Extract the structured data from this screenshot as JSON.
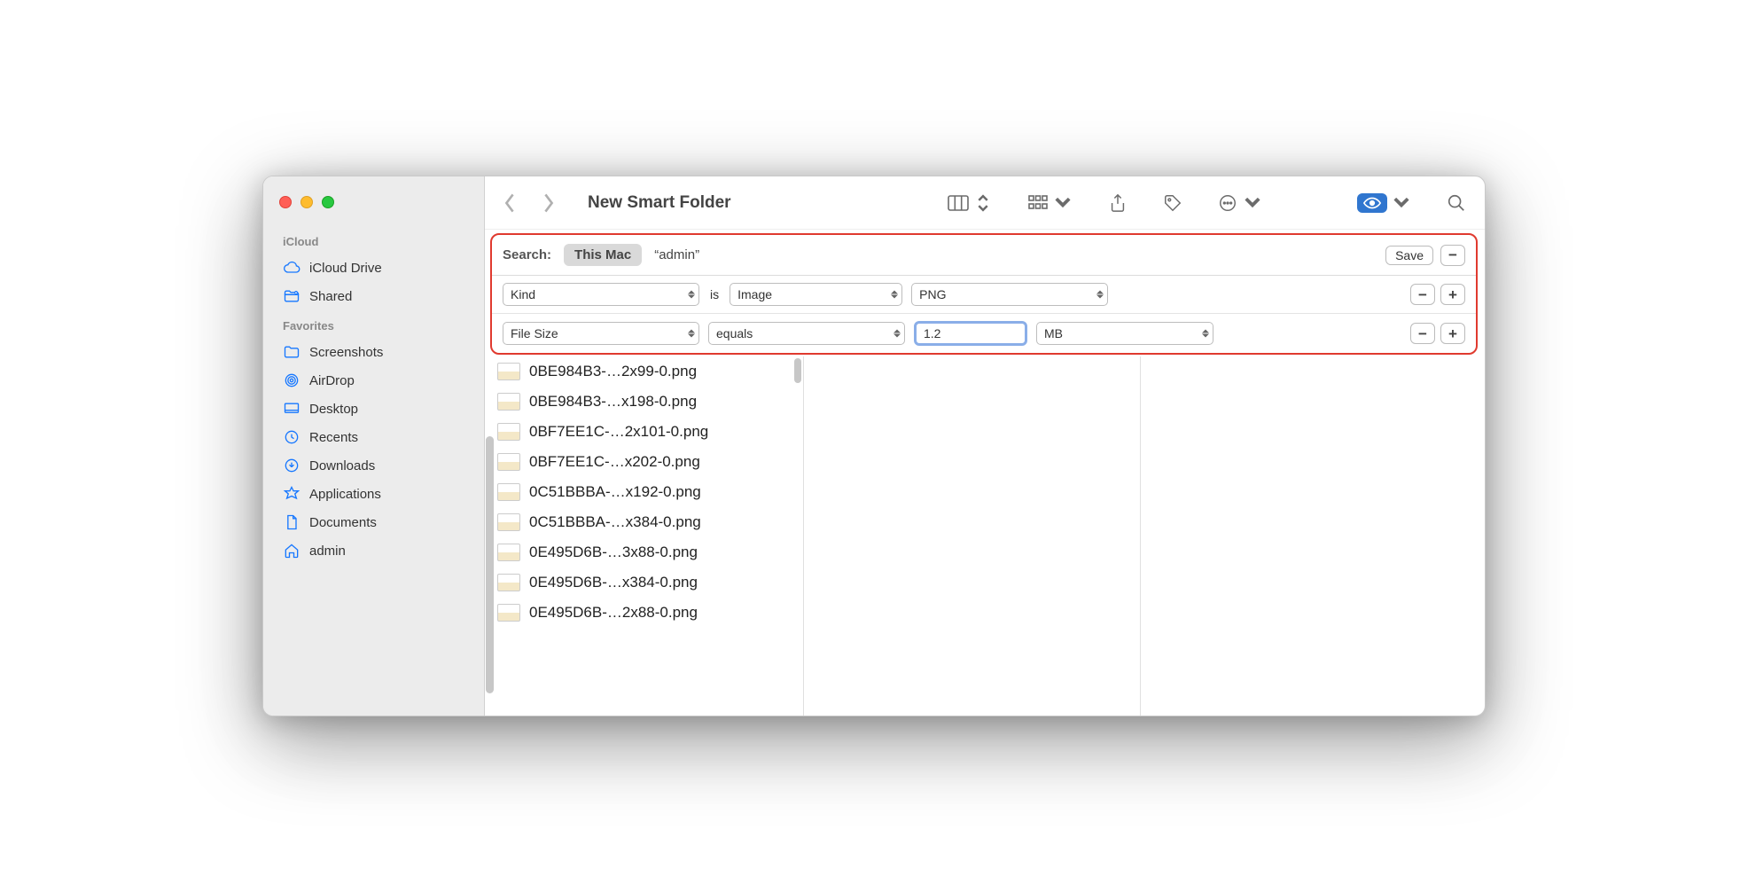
{
  "window": {
    "title": "New Smart Folder"
  },
  "sidebar": {
    "sections": [
      {
        "header": "iCloud",
        "items": [
          {
            "label": "iCloud Drive"
          },
          {
            "label": "Shared"
          }
        ]
      },
      {
        "header": "Favorites",
        "items": [
          {
            "label": "Screenshots"
          },
          {
            "label": "AirDrop"
          },
          {
            "label": "Desktop"
          },
          {
            "label": "Recents"
          },
          {
            "label": "Downloads"
          },
          {
            "label": "Applications"
          },
          {
            "label": "Documents"
          },
          {
            "label": "admin"
          }
        ]
      }
    ]
  },
  "search": {
    "label": "Search:",
    "scope_selected": "This Mac",
    "scope_other": "admin",
    "save_label": "Save"
  },
  "criteria": [
    {
      "attribute": "Kind",
      "joiner": "is",
      "value1": "Image",
      "value2": "PNG"
    },
    {
      "attribute": "File Size",
      "joiner": "equals",
      "input": "1.2",
      "unit": "MB"
    }
  ],
  "files": [
    "0BE984B3-…2x99-0.png",
    "0BE984B3-…x198-0.png",
    "0BF7EE1C-…2x101-0.png",
    "0BF7EE1C-…x202-0.png",
    "0C51BBBA-…x192-0.png",
    "0C51BBBA-…x384-0.png",
    "0E495D6B-…3x88-0.png",
    "0E495D6B-…x384-0.png",
    "0E495D6B-…2x88-0.png"
  ]
}
